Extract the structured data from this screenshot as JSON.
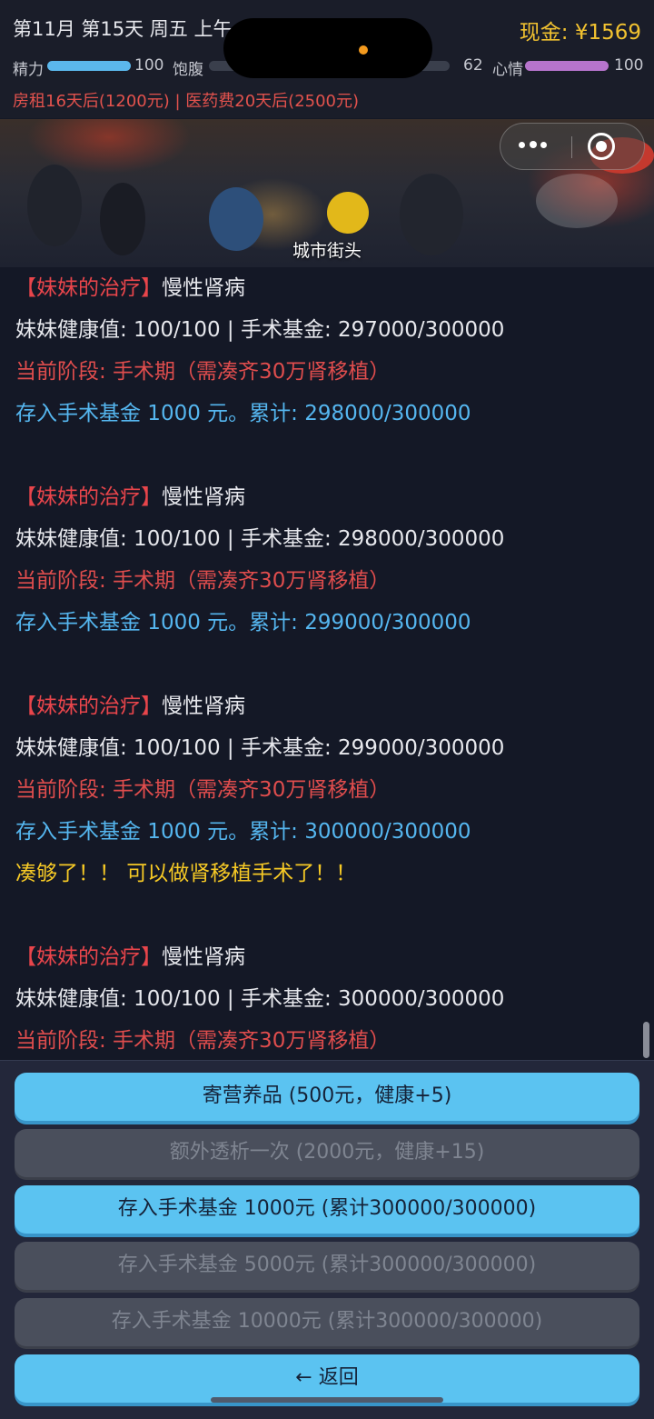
{
  "header": {
    "date_line": "第11月 第15天 周五 上午",
    "cash": "现金: ¥1569",
    "stats": [
      {
        "label": "精力",
        "value": "100",
        "level": 1.0,
        "color": "#5bb7ec"
      },
      {
        "label": "饱腹",
        "value": "62",
        "level": 0.62,
        "color": "#3a3f4c"
      },
      {
        "label": "心情",
        "value": "100",
        "level": 1.0,
        "color": "#b674cc"
      }
    ],
    "bills": "房租16天后(1200元) | 医药费20天后(2500元)"
  },
  "scene": {
    "caption": "城市街头"
  },
  "log": [
    {
      "style": "title",
      "text": "【妹妹的治疗】",
      "rest": "慢性肾病"
    },
    {
      "style": "white",
      "text": "妹妹健康值: 100/100 | 手术基金: 297000/300000"
    },
    {
      "style": "red",
      "text": "当前阶段: 手术期（需凑齐30万肾移植）"
    },
    {
      "style": "blue",
      "text": "存入手术基金 1000 元。累计: 298000/300000"
    },
    {
      "style": "gap"
    },
    {
      "style": "title",
      "text": "【妹妹的治疗】",
      "rest": "慢性肾病"
    },
    {
      "style": "white",
      "text": "妹妹健康值: 100/100 | 手术基金: 298000/300000"
    },
    {
      "style": "red",
      "text": "当前阶段: 手术期（需凑齐30万肾移植）"
    },
    {
      "style": "blue",
      "text": "存入手术基金 1000 元。累计: 299000/300000"
    },
    {
      "style": "gap"
    },
    {
      "style": "title",
      "text": "【妹妹的治疗】",
      "rest": "慢性肾病"
    },
    {
      "style": "white",
      "text": "妹妹健康值: 100/100 | 手术基金: 299000/300000"
    },
    {
      "style": "red",
      "text": "当前阶段: 手术期（需凑齐30万肾移植）"
    },
    {
      "style": "blue",
      "text": "存入手术基金 1000 元。累计: 300000/300000"
    },
    {
      "style": "yellow",
      "text": "凑够了！！ 可以做肾移植手术了！！"
    },
    {
      "style": "gap"
    },
    {
      "style": "title",
      "text": "【妹妹的治疗】",
      "rest": "慢性肾病"
    },
    {
      "style": "white",
      "text": "妹妹健康值: 100/100 | 手术基金: 300000/300000"
    },
    {
      "style": "red",
      "text": "当前阶段: 手术期（需凑齐30万肾移植）"
    }
  ],
  "actions": [
    {
      "label": "寄营养品 (500元，健康+5)",
      "enabled": true
    },
    {
      "label": "额外透析一次 (2000元，健康+15)",
      "enabled": false
    },
    {
      "label": "存入手术基金 1000元 (累计300000/300000)",
      "enabled": true
    },
    {
      "label": "存入手术基金 5000元 (累计300000/300000)",
      "enabled": false
    },
    {
      "label": "存入手术基金 10000元 (累计300000/300000)",
      "enabled": false
    },
    {
      "label": "← 返回",
      "enabled": true
    }
  ],
  "colors": {
    "background": "#141826",
    "cash": "#f2c230",
    "alert_red": "#df4d4d",
    "info_blue": "#55b6ef",
    "success_yellow": "#f6c925",
    "button_active": "#5bc3f1",
    "button_disabled": "#4a4f5c"
  }
}
